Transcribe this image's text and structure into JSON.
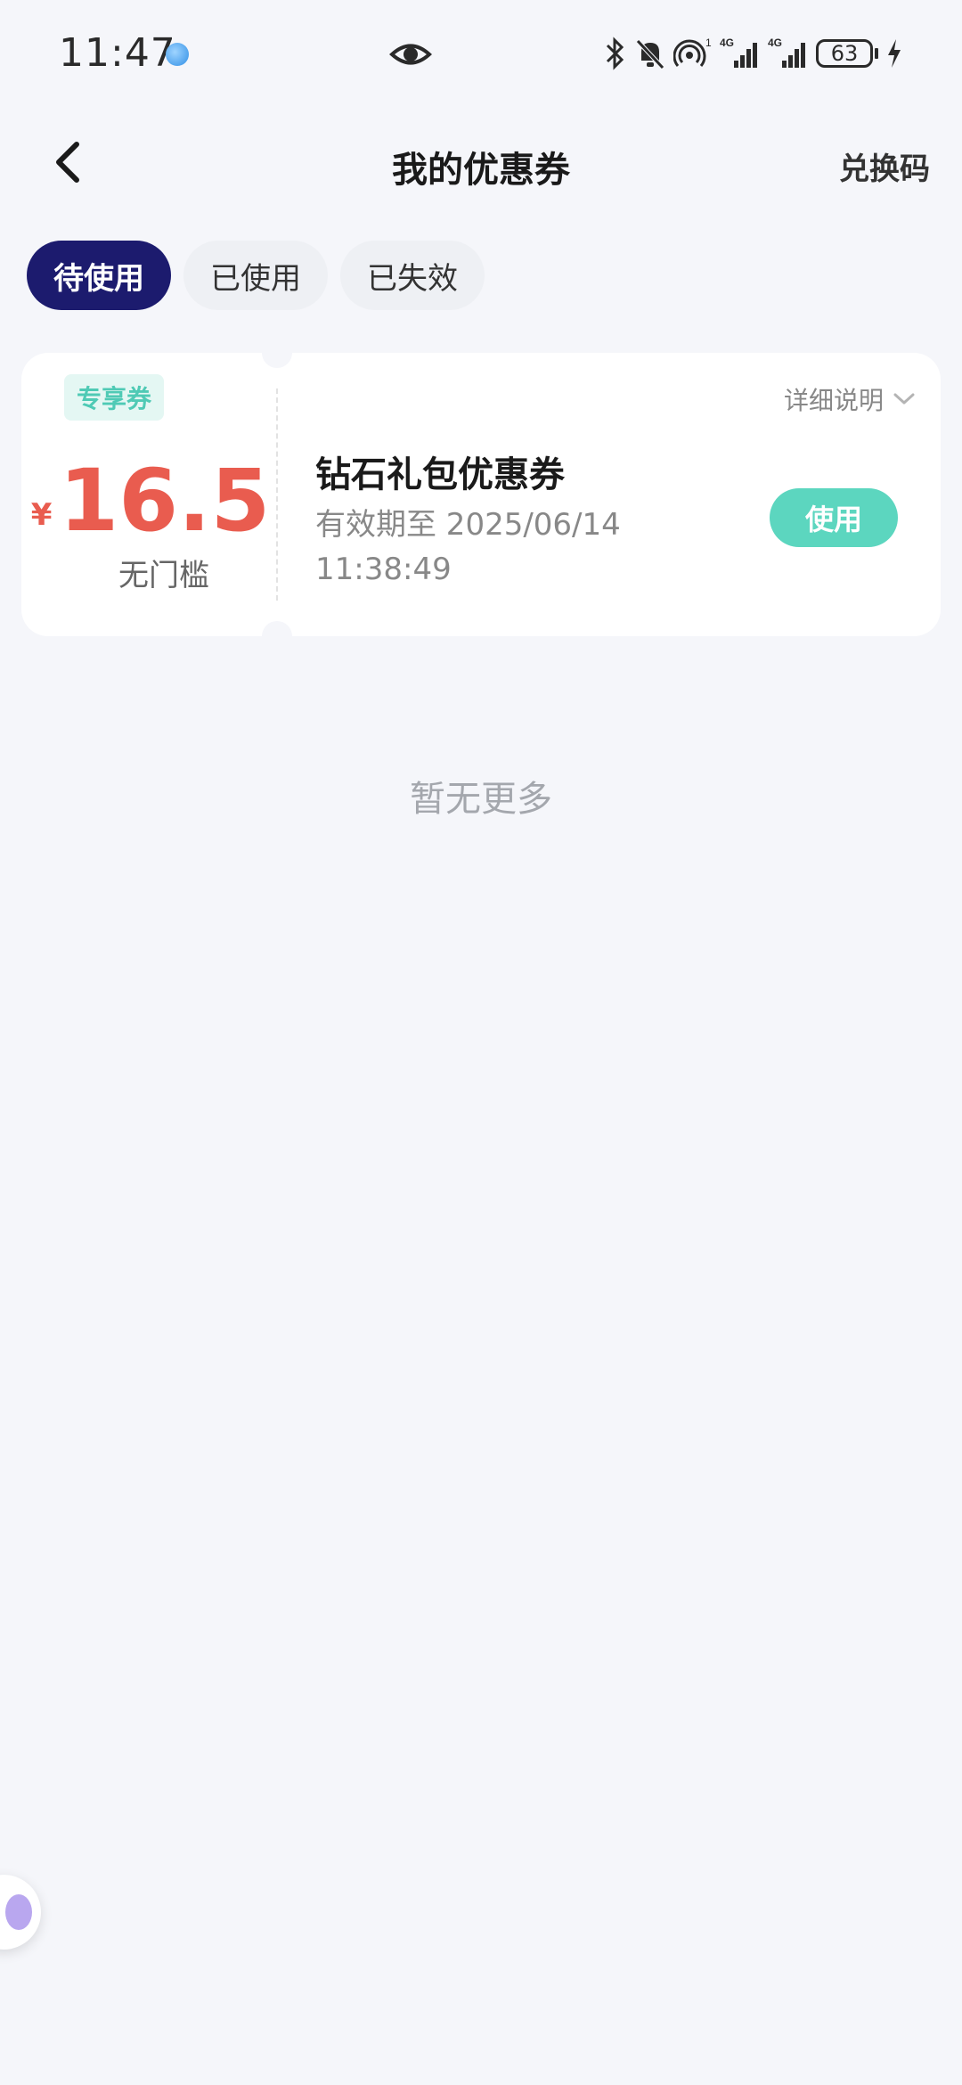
{
  "status_bar": {
    "time": "11:47",
    "network_1": "4G",
    "network_2": "4G",
    "hotspot_index": "1",
    "battery": "63"
  },
  "header": {
    "title": "我的优惠券",
    "redeem_code": "兑换码"
  },
  "tabs": [
    {
      "label": "待使用",
      "active": true
    },
    {
      "label": "已使用",
      "active": false
    },
    {
      "label": "已失效",
      "active": false
    }
  ],
  "coupon": {
    "badge": "专享券",
    "currency": "¥",
    "amount": "16.5",
    "threshold": "无门槛",
    "detail_label": "详细说明",
    "name": "钻石礼包优惠券",
    "valid_until": "有效期至 2025/06/14 11:38:49",
    "use_label": "使用"
  },
  "footer_text": "暂无更多",
  "colors": {
    "active_tab": "#1c1b6e",
    "amount": "#e95c4f",
    "use_button": "#5cd6bf",
    "badge_text": "#4fcab5",
    "background": "#f5f6fa"
  }
}
